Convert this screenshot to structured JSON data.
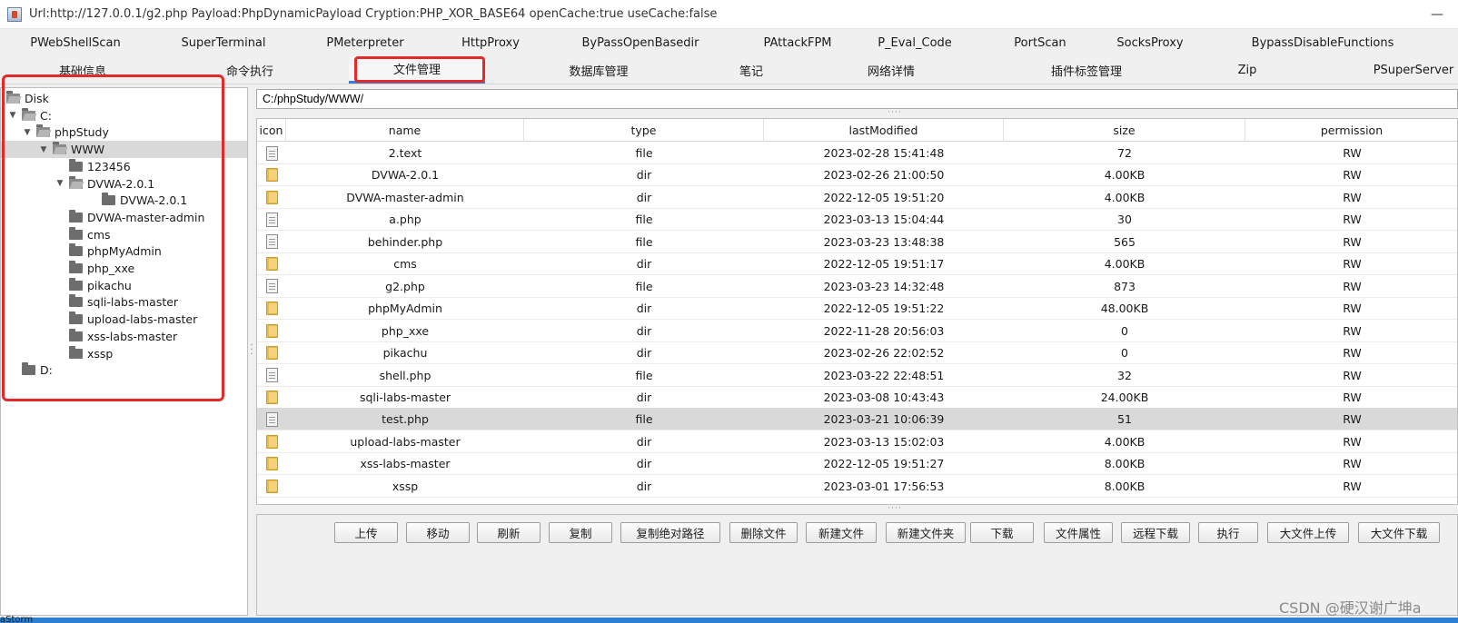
{
  "window": {
    "title": "Url:http://127.0.0.1/g2.php Payload:PhpDynamicPayload Cryption:PHP_XOR_BASE64 openCache:true useCache:false",
    "minimize_glyph": "—"
  },
  "tabs_row1": [
    "PWebShellScan",
    "SuperTerminal",
    "PMeterpreter",
    "HttpProxy",
    "ByPassOpenBasedir",
    "PAttackFPM",
    "P_Eval_Code",
    "PortScan",
    "SocksProxy",
    "BypassDisableFunctions"
  ],
  "tabs_row2": [
    "基础信息",
    "命令执行",
    "文件管理",
    "数据库管理",
    "笔记",
    "网络详情",
    "插件标签管理",
    "Zip",
    "PSuperServer"
  ],
  "active_tab": "文件管理",
  "tree": [
    {
      "label": "Disk",
      "depth": 0,
      "expanded": true
    },
    {
      "label": "C:",
      "depth": 1,
      "expanded": true
    },
    {
      "label": "phpStudy",
      "depth": 2,
      "expanded": true
    },
    {
      "label": "WWW",
      "depth": 3,
      "expanded": true,
      "selected": true
    },
    {
      "label": "123456",
      "depth": 4
    },
    {
      "label": "DVWA-2.0.1",
      "depth": 4,
      "expanded": true
    },
    {
      "label": "DVWA-2.0.1",
      "depth": 5
    },
    {
      "label": "DVWA-master-admin",
      "depth": 4
    },
    {
      "label": "cms",
      "depth": 4
    },
    {
      "label": "phpMyAdmin",
      "depth": 4
    },
    {
      "label": "php_xxe",
      "depth": 4
    },
    {
      "label": "pikachu",
      "depth": 4
    },
    {
      "label": "sqli-labs-master",
      "depth": 4
    },
    {
      "label": "upload-labs-master",
      "depth": 4
    },
    {
      "label": "xss-labs-master",
      "depth": 4
    },
    {
      "label": "xssp",
      "depth": 4
    },
    {
      "label": "D:",
      "depth": 1
    }
  ],
  "path": {
    "value": "C:/phpStudy/WWW/"
  },
  "table": {
    "columns": [
      "icon",
      "name",
      "type",
      "lastModified",
      "size",
      "permission"
    ],
    "rows": [
      {
        "name": "2.text",
        "type": "file",
        "lastModified": "2023-02-28 15:41:48",
        "size": "72",
        "permission": "RW"
      },
      {
        "name": "DVWA-2.0.1",
        "type": "dir",
        "lastModified": "2023-02-26 21:00:50",
        "size": "4.00KB",
        "permission": "RW"
      },
      {
        "name": "DVWA-master-admin",
        "type": "dir",
        "lastModified": "2022-12-05 19:51:20",
        "size": "4.00KB",
        "permission": "RW"
      },
      {
        "name": "a.php",
        "type": "file",
        "lastModified": "2023-03-13 15:04:44",
        "size": "30",
        "permission": "RW"
      },
      {
        "name": "behinder.php",
        "type": "file",
        "lastModified": "2023-03-23 13:48:38",
        "size": "565",
        "permission": "RW"
      },
      {
        "name": "cms",
        "type": "dir",
        "lastModified": "2022-12-05 19:51:17",
        "size": "4.00KB",
        "permission": "RW"
      },
      {
        "name": "g2.php",
        "type": "file",
        "lastModified": "2023-03-23 14:32:48",
        "size": "873",
        "permission": "RW"
      },
      {
        "name": "phpMyAdmin",
        "type": "dir",
        "lastModified": "2022-12-05 19:51:22",
        "size": "48.00KB",
        "permission": "RW"
      },
      {
        "name": "php_xxe",
        "type": "dir",
        "lastModified": "2022-11-28 20:56:03",
        "size": "0",
        "permission": "RW"
      },
      {
        "name": "pikachu",
        "type": "dir",
        "lastModified": "2023-02-26 22:02:52",
        "size": "0",
        "permission": "RW"
      },
      {
        "name": "shell.php",
        "type": "file",
        "lastModified": "2023-03-22 22:48:51",
        "size": "32",
        "permission": "RW"
      },
      {
        "name": "sqli-labs-master",
        "type": "dir",
        "lastModified": "2023-03-08 10:43:43",
        "size": "24.00KB",
        "permission": "RW"
      },
      {
        "name": "test.php",
        "type": "file",
        "lastModified": "2023-03-21 10:06:39",
        "size": "51",
        "permission": "RW",
        "selected": true
      },
      {
        "name": "upload-labs-master",
        "type": "dir",
        "lastModified": "2023-03-13 15:02:03",
        "size": "4.00KB",
        "permission": "RW"
      },
      {
        "name": "xss-labs-master",
        "type": "dir",
        "lastModified": "2022-12-05 19:51:27",
        "size": "8.00KB",
        "permission": "RW"
      },
      {
        "name": "xssp",
        "type": "dir",
        "lastModified": "2023-03-01 17:56:53",
        "size": "8.00KB",
        "permission": "RW"
      }
    ]
  },
  "buttons": [
    "上传",
    "移动",
    "刷新",
    "复制",
    "复制绝对路径",
    "删除文件",
    "新建文件",
    "新建文件夹",
    "下载",
    "文件属性",
    "远程下载",
    "执行",
    "大文件上传",
    "大文件下载"
  ],
  "watermark": "CSDN @硬汉谢广坤a",
  "taskbar_fragment": "aStorm",
  "colors": {
    "highlight_box": "#e12a2a",
    "active_tab_underline": "#3d7bd6",
    "selection": "#d9d9d9",
    "folder_icon": "#e9b94a",
    "taskbar": "#2c7fd1"
  }
}
